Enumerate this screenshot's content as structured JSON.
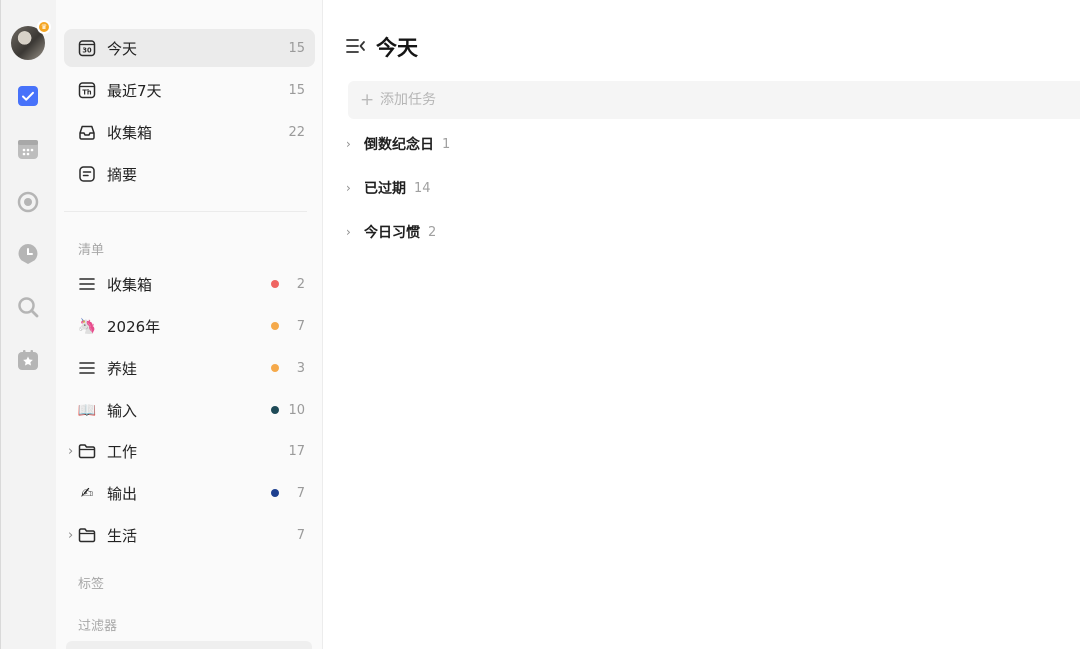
{
  "rail": {
    "items": [
      {
        "name": "tasks",
        "icon": "checkbox-icon",
        "active": true
      },
      {
        "name": "calendar",
        "icon": "calendar-icon"
      },
      {
        "name": "habit",
        "icon": "target-icon"
      },
      {
        "name": "focus",
        "icon": "clock-icon"
      },
      {
        "name": "search",
        "icon": "search-icon"
      },
      {
        "name": "matrix",
        "icon": "star-badge-icon"
      }
    ],
    "accent": "#4772fa"
  },
  "smart_lists": [
    {
      "label": "今天",
      "count": "15",
      "icon": "calendar-30-icon",
      "icon_text": "30",
      "active": true
    },
    {
      "label": "最近7天",
      "count": "15",
      "icon": "calendar-th-icon",
      "icon_text": "Th"
    },
    {
      "label": "收集箱",
      "count": "22",
      "icon": "inbox-icon"
    },
    {
      "label": "摘要",
      "count": "",
      "icon": "summary-icon"
    }
  ],
  "lists_section": {
    "title": "清单",
    "items": [
      {
        "label": "收集箱",
        "count": "2",
        "icon": "list-icon",
        "dot": "#ef6461"
      },
      {
        "label": "2026年",
        "count": "7",
        "icon": "unicorn-icon",
        "emoji": "🦄",
        "dot": "#f5a94a"
      },
      {
        "label": "养娃",
        "count": "3",
        "icon": "list-icon",
        "dot": "#f5a94a"
      },
      {
        "label": "输入",
        "count": "10",
        "icon": "book-icon",
        "emoji": "📖",
        "dot": "#1e4a57"
      },
      {
        "label": "工作",
        "count": "17",
        "icon": "folder-icon",
        "folder": true
      },
      {
        "label": "输出",
        "count": "7",
        "icon": "writing-hand-icon",
        "emoji": "✍",
        "dot": "#1d3f8f"
      },
      {
        "label": "生活",
        "count": "7",
        "icon": "folder-icon",
        "folder": true
      }
    ]
  },
  "tags_section": {
    "title": "标签"
  },
  "filters_section": {
    "title": "过滤器"
  },
  "main": {
    "title": "今天",
    "add_task_placeholder": "添加任务",
    "groups": [
      {
        "name": "倒数纪念日",
        "count": "1"
      },
      {
        "name": "已过期",
        "count": "14"
      },
      {
        "name": "今日习惯",
        "count": "2"
      }
    ]
  }
}
